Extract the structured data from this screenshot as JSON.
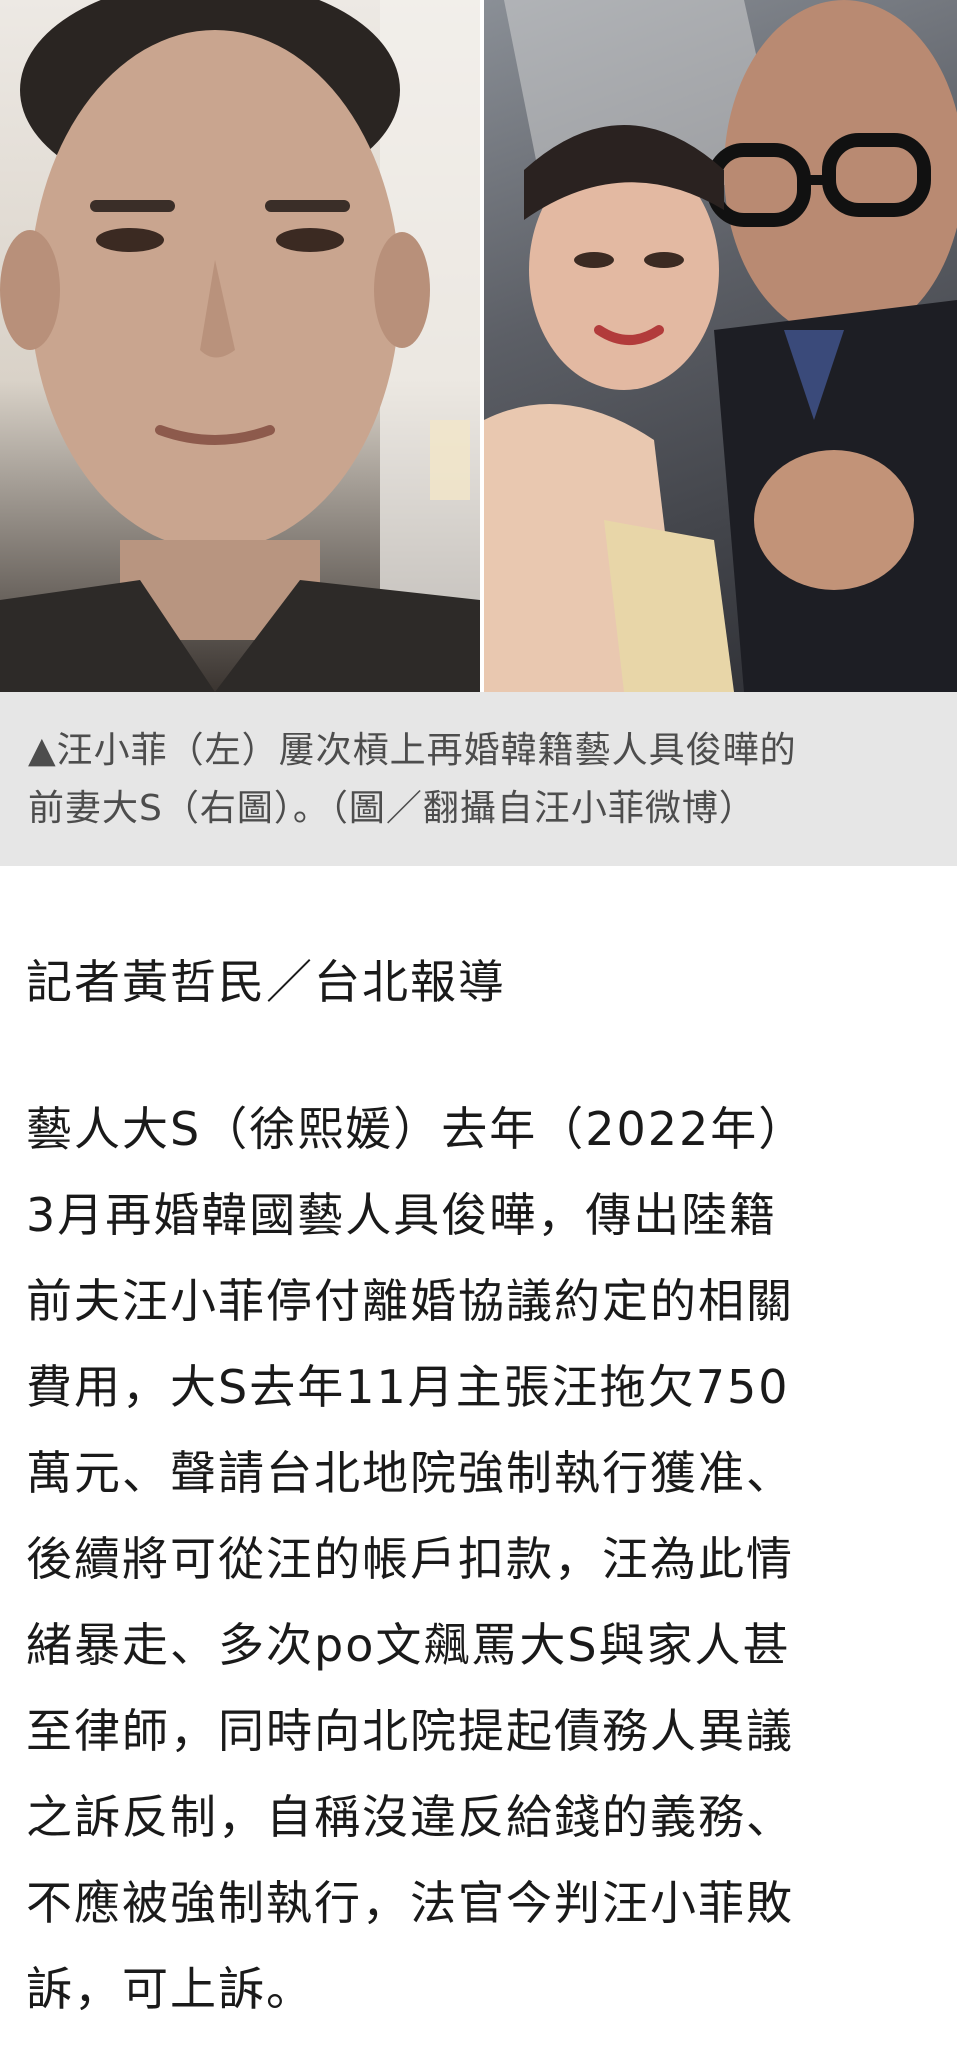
{
  "photos": {
    "left_icon": "portrait-photo-icon",
    "right_icon": "wedding-photo-icon"
  },
  "caption": {
    "line1": "▲汪小菲（左）屢次槓上再婚韓籍藝人具俊曄的",
    "line2": "前妻大S（右圖）。（圖／翻攝自汪小菲微博）"
  },
  "byline": "記者黃哲民／台北報導",
  "article": {
    "lines": [
      "藝人大S（徐熙媛）去年（2022年）",
      "3月再婚韓國藝人具俊曄，傳出陸籍",
      "前夫汪小菲停付離婚協議約定的相關",
      "費用，大S去年11月主張汪拖欠750",
      "萬元、聲請台北地院強制執行獲准、",
      "後續將可從汪的帳戶扣款，汪為此情",
      "緒暴走、多次po文飆罵大S與家人甚",
      "至律師，同時向北院提起債務人異議",
      "之訴反制，自稱沒違反給錢的義務、",
      "不應被強制執行，法官今判汪小菲敗",
      "訴，可上訴。"
    ]
  },
  "colors": {
    "caption_bg": "#e6e6e6",
    "caption_text": "#4d4d4d",
    "body_text": "#1a1a1a"
  }
}
